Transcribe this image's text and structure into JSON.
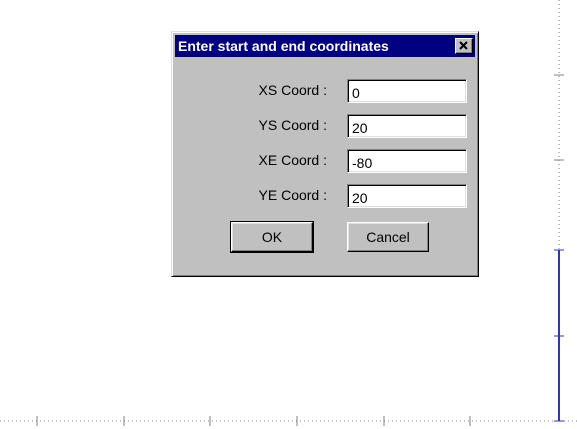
{
  "dialog": {
    "title": "Enter start and end coordinates",
    "close_icon": "close-icon",
    "fields": [
      {
        "label": "XS Coord :",
        "value": "0"
      },
      {
        "label": "YS Coord :",
        "value": "20"
      },
      {
        "label": "XE Coord :",
        "value": "-80"
      },
      {
        "label": "YE Coord :",
        "value": "20"
      }
    ],
    "ok_label": "OK",
    "cancel_label": "Cancel"
  },
  "colors": {
    "titlebar": "#000080",
    "dialog_face": "#c0c0c0",
    "drawn_line": "#3333bb",
    "axis_dots": "#808080"
  }
}
